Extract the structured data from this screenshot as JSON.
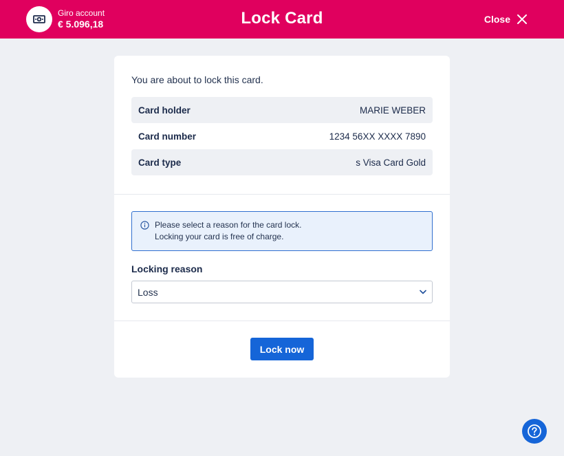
{
  "header": {
    "account_label": "Giro account",
    "account_balance": "€ 5.096,18",
    "account_icon": "banknote-icon",
    "title": "Lock Card",
    "close_label": "Close",
    "close_icon": "close-icon",
    "brand_color": "#e0005e"
  },
  "card": {
    "intro": "You are about to lock this card.",
    "details": [
      {
        "label": "Card holder",
        "value": "MARIE WEBER"
      },
      {
        "label": "Card number",
        "value": "1234 56XX XXXX 7890"
      },
      {
        "label": "Card type",
        "value": "s Visa Card Gold"
      }
    ],
    "info": {
      "icon": "info-icon",
      "line1": "Please select a reason for the card lock.",
      "line2": "Locking your card is free of charge."
    },
    "reason_label": "Locking reason",
    "reason_selected": "Loss",
    "submit_label": "Lock now",
    "accent_color": "#1565d8"
  },
  "help": {
    "icon": "help-icon"
  }
}
